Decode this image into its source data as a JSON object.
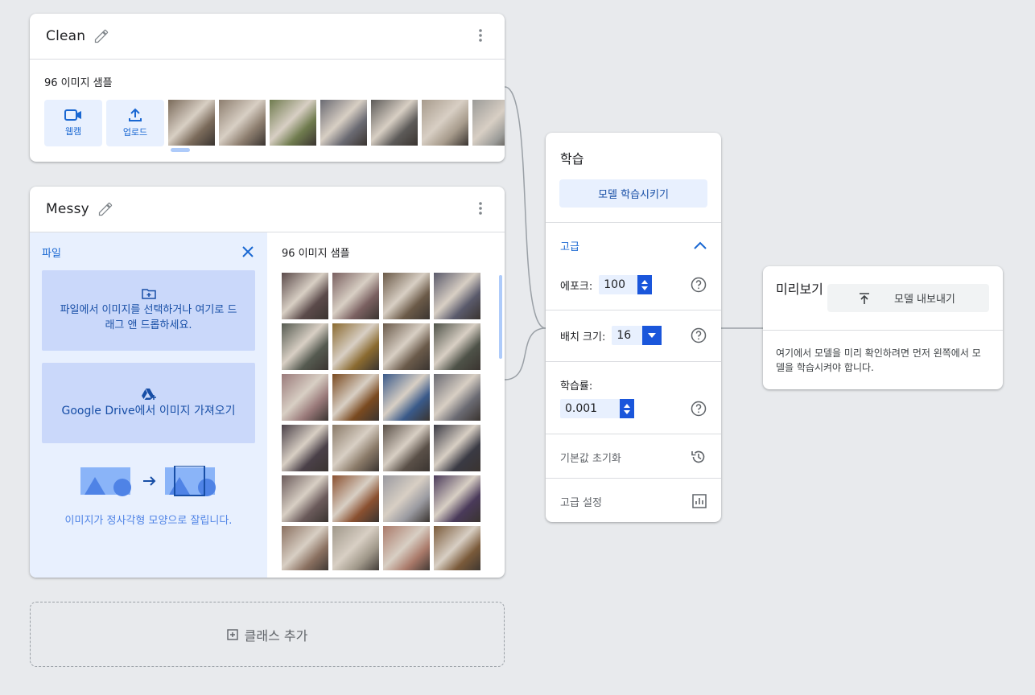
{
  "classes": [
    {
      "name": "Clean",
      "sample_count": "96 이미지 샘플",
      "webcam_label": "웹캠",
      "upload_label": "업로드",
      "thumb_colors": [
        "#7a6a5a",
        "#8d7e6f",
        "#6f7b4e",
        "#6a6a72",
        "#5c5a58",
        "#a79b8c",
        "#9b9b98"
      ]
    },
    {
      "name": "Messy",
      "sample_count": "96 이미지 샘플",
      "file_panel": {
        "title": "파일",
        "from_file": "파일에서 이미지를 선택하거나 여기로 드래그 앤 드롭하세요.",
        "from_drive": "Google Drive에서 이미지 가져오기",
        "crop_note": "이미지가 정사각형 모양으로 잘립니다."
      },
      "thumb_colors": [
        "#5b4a4a",
        "#7a6060",
        "#6b5a48",
        "#5a5a6b",
        "#555a50",
        "#8a6a30",
        "#6a5a4a",
        "#4e5248",
        "#9a7a7a",
        "#7a4a20",
        "#3a5a8a",
        "#6a6a72",
        "#4a4048",
        "#8a7a68",
        "#5a5048",
        "#3a3a44",
        "#6a5a5a",
        "#8a5030",
        "#9a9aa0",
        "#4a3a5a",
        "#8a7060",
        "#a0988a",
        "#aa7a6a",
        "#7a5a3a"
      ]
    }
  ],
  "add_class": "클래스 추가",
  "training": {
    "title": "학습",
    "train_button": "모델 학습시키기",
    "advanced": "고급",
    "epochs_label": "에포크:",
    "epochs_value": "100",
    "batch_label": "배치 크기:",
    "batch_value": "16",
    "lr_label": "학습률:",
    "lr_value": "0.001",
    "reset_defaults": "기본값 초기화",
    "advanced_settings": "고급 설정"
  },
  "preview": {
    "title": "미리보기",
    "export_button": "모델 내보내기",
    "note": "여기에서 모델을 미리 확인하려면 먼저 왼쪽에서 모델을 학습시켜야 합니다."
  },
  "colors": {
    "accent": "#1a56db",
    "accent_light": "#e8f0fe",
    "drop_zone": "#cad8fa",
    "panel_bg": "#e8f0fe"
  }
}
